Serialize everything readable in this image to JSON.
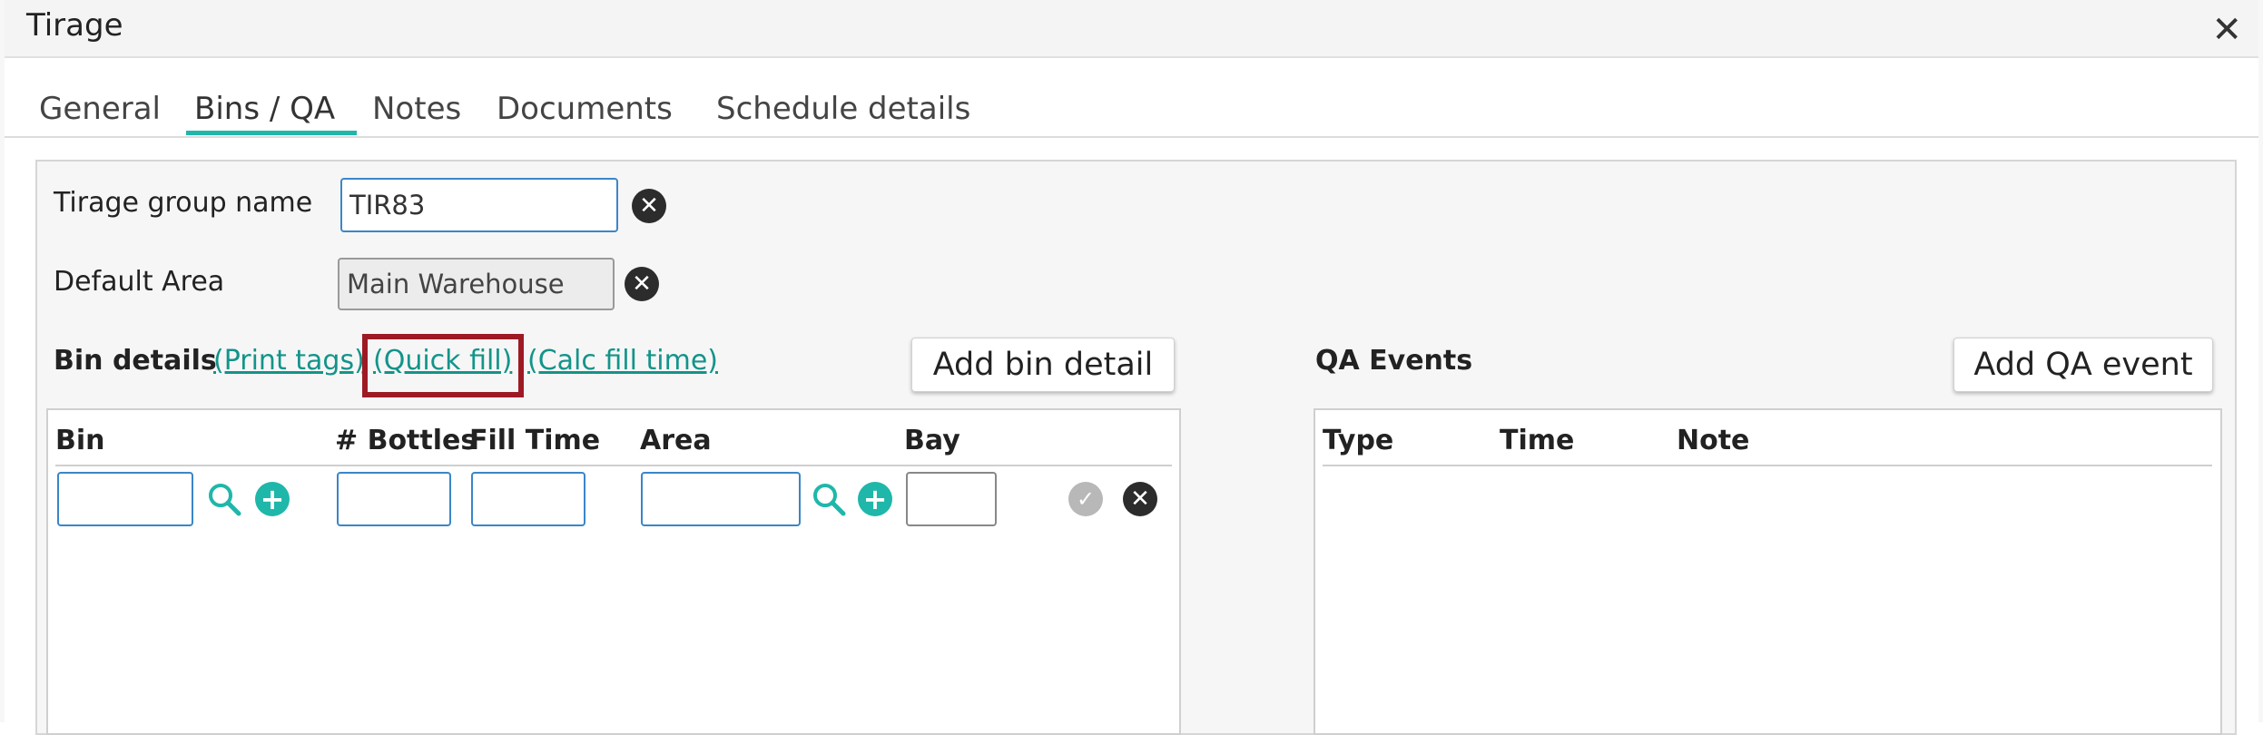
{
  "window": {
    "title": "Tirage",
    "close_glyph": "✕"
  },
  "tabs": [
    {
      "label": "General"
    },
    {
      "label": "Bins / QA",
      "active": true
    },
    {
      "label": "Notes"
    },
    {
      "label": "Documents"
    },
    {
      "label": "Schedule details"
    }
  ],
  "form": {
    "group_name_label": "Tirage group name",
    "group_name_value": "TIR83",
    "default_area_label": "Default Area",
    "default_area_value": "Main Warehouse"
  },
  "bin_details": {
    "title": "Bin details",
    "links": {
      "print_tags": "(Print tags)",
      "quick_fill": "(Quick fill)",
      "calc_fill_time": "(Calc fill time)"
    },
    "add_button": "Add bin detail",
    "columns": {
      "bin": "Bin",
      "bottles": "# Bottles",
      "fill_time": "Fill Time",
      "area": "Area",
      "bay": "Bay"
    }
  },
  "qa_events": {
    "title": "QA Events",
    "add_button": "Add QA event",
    "columns": {
      "type": "Type",
      "time": "Time",
      "note": "Note"
    }
  },
  "icons": {
    "clear": "x-circle-icon",
    "search": "search-icon",
    "add": "plus-circle-icon",
    "confirm": "check-circle-icon"
  },
  "colors": {
    "accent": "#1fb7aa",
    "link": "#13948a",
    "highlight": "#9d1a24",
    "input_border": "#3a86c8"
  }
}
